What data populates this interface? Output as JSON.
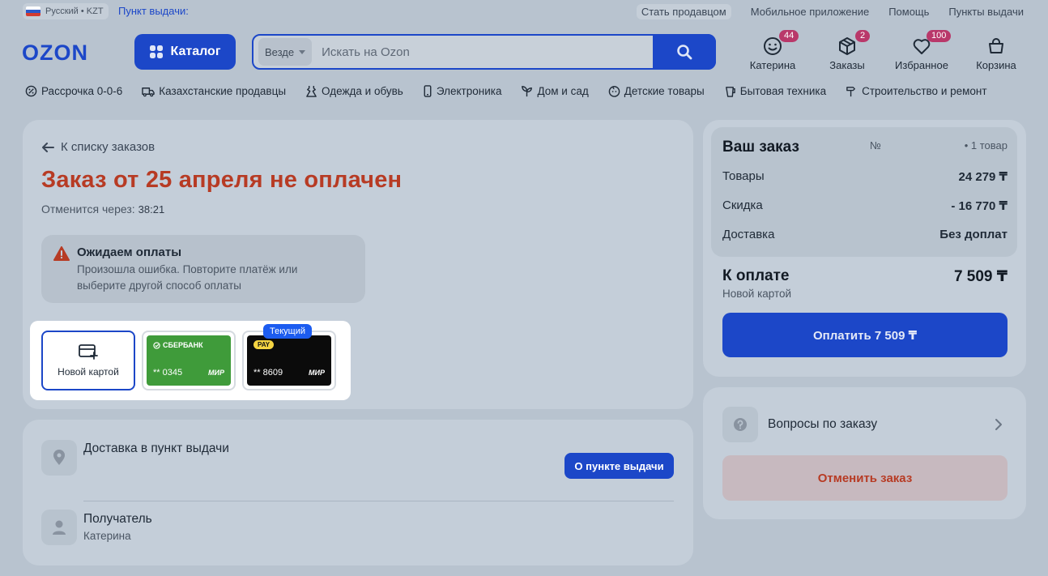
{
  "topbar": {
    "locale": "Русский • KZT",
    "pickup_point": "Пункт выдачи:",
    "links": [
      "Стать продавцом",
      "Мобильное приложение",
      "Помощь",
      "Пункты выдачи"
    ]
  },
  "header": {
    "logo": "OZON",
    "catalog": "Каталог",
    "search_scope": "Везде",
    "search_placeholder": "Искать на Ozon",
    "icons": [
      {
        "label": "Катерина",
        "badge": "44",
        "icon": "profile-icon"
      },
      {
        "label": "Заказы",
        "badge": "2",
        "icon": "box-icon"
      },
      {
        "label": "Избранное",
        "badge": "100",
        "icon": "heart-icon"
      },
      {
        "label": "Корзина",
        "badge": "",
        "icon": "cart-icon"
      }
    ]
  },
  "nav": [
    "Рассрочка 0-0-6",
    "Казахстанские продавцы",
    "Одежда и обувь",
    "Электроника",
    "Дом и сад",
    "Детские товары",
    "Бытовая техника",
    "Строительство и ремонт"
  ],
  "order": {
    "back": "К списку заказов",
    "title": "Заказ от 25 апреля не оплачен",
    "cancel_in_label": "Отменится через:",
    "cancel_in_value": "38:21",
    "warning_title": "Ожидаем оплаты",
    "warning_text": "Произошла ошибка. Повторите платёж или выберите другой способ оплаты"
  },
  "payment": {
    "new_card": "Новой картой",
    "current_tag": "Текущий",
    "cards": [
      {
        "brand": "СБЕРБАНК",
        "number": "** 0345",
        "network": "МИР"
      },
      {
        "brand": "PAY",
        "number": "** 8609",
        "network": "МИР"
      }
    ]
  },
  "delivery": {
    "title": "Доставка в пункт выдачи",
    "subtitle": "",
    "button": "О пункте выдачи",
    "recipient_title": "Получатель",
    "recipient_name": "Катерина"
  },
  "summary": {
    "title": "Ваш заказ",
    "number_label": "№",
    "count": "• 1 товар",
    "rows": [
      {
        "label": "Товары",
        "value": "24 279 ₸"
      },
      {
        "label": "Скидка",
        "value": "- 16 770 ₸"
      },
      {
        "label": "Доставка",
        "value": "Без доплат"
      }
    ],
    "to_pay_label": "К оплате",
    "to_pay_value": "7 509 ₸",
    "to_pay_method": "Новой картой",
    "pay_button": "Оплатить 7 509 ₸",
    "questions": "Вопросы по заказу",
    "cancel_button": "Отменить заказ"
  },
  "colors": {
    "accent": "#1c47c8",
    "danger": "#b73b24",
    "badge": "#b9386a"
  }
}
